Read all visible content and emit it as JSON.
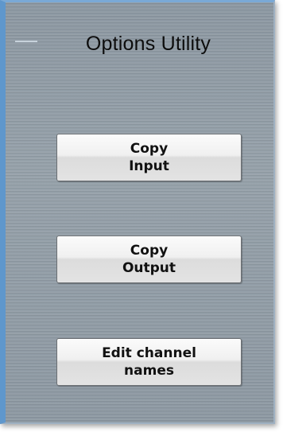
{
  "window": {
    "title": "Options Utility"
  },
  "buttons": {
    "copy_input": "Copy\nInput",
    "copy_output": "Copy\nOutput",
    "edit_channel_names": "Edit channel\nnames"
  },
  "colors": {
    "frame_accent": "#5f97cc",
    "panel_background": "#8f9aa3",
    "button_face": "#efefef"
  }
}
